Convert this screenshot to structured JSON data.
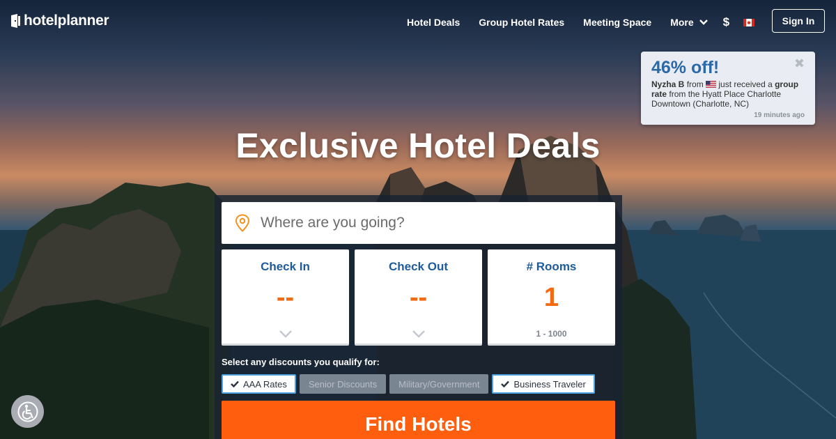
{
  "brand": {
    "logo_text": "hotelplanner"
  },
  "nav": {
    "items": [
      "Hotel Deals",
      "Group Hotel Rates",
      "Meeting Space"
    ],
    "more_label": "More",
    "currency_symbol": "$",
    "signin_label": "Sign In"
  },
  "toast": {
    "title": "46% off!",
    "name": "Nyzha B",
    "from_text": "from",
    "mid_text": "just received a",
    "bold_phrase": "group rate",
    "rest_text": "from the Hyatt Place Charlotte Downtown (Charlotte, NC)",
    "time": "19 minutes ago",
    "close_symbol": "✖"
  },
  "hero": {
    "title": "Exclusive Hotel Deals"
  },
  "search": {
    "placeholder": "Where are you going?"
  },
  "boxes": {
    "check_in": {
      "label": "Check In",
      "value": "--"
    },
    "check_out": {
      "label": "Check Out",
      "value": "--"
    },
    "rooms": {
      "label": "# Rooms",
      "value": "1",
      "range": "1 - 1000"
    }
  },
  "discounts": {
    "label": "Select any discounts you qualify for:",
    "options": [
      {
        "label": "AAA Rates",
        "selected": true
      },
      {
        "label": "Senior Discounts",
        "selected": false
      },
      {
        "label": "Military/Government",
        "selected": false
      },
      {
        "label": "Business Traveler",
        "selected": true
      }
    ]
  },
  "cta": {
    "label": "Find Hotels"
  },
  "colors": {
    "accent_orange": "#ff5e0e",
    "brand_blue": "#1d5b9a",
    "toast_blue": "#2b68a8"
  },
  "icons": [
    "logo-icon",
    "chevron-down-icon",
    "canada-flag-icon",
    "usa-flag-icon",
    "map-pin-icon",
    "check-icon",
    "accessibility-icon",
    "close-icon"
  ]
}
